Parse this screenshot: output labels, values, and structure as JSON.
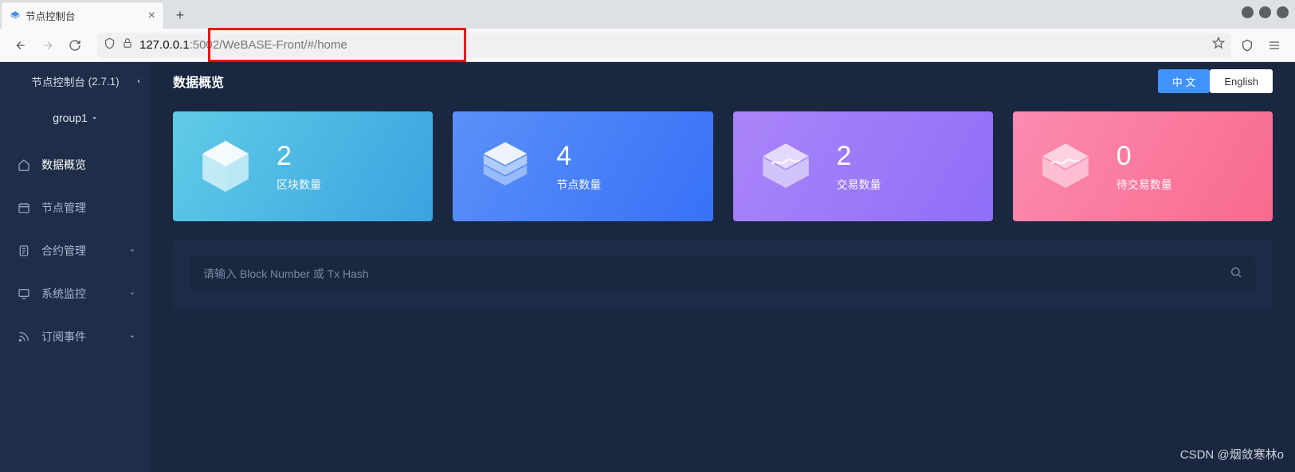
{
  "browser": {
    "tab_title": "节点控制台",
    "url_host": "127.0.0.1",
    "url_rest": ":5002/WeBASE-Front/#/home"
  },
  "sidebar": {
    "app_name": "节点控制台",
    "version": "(2.7.1)",
    "group_label": "group1",
    "items": [
      {
        "label": "数据概览",
        "icon": "home-icon",
        "active": true
      },
      {
        "label": "节点管理",
        "icon": "calendar-icon"
      },
      {
        "label": "合约管理",
        "icon": "clipboard-icon",
        "expandable": true
      },
      {
        "label": "系统监控",
        "icon": "monitor-icon",
        "expandable": true
      },
      {
        "label": "订阅事件",
        "icon": "rss-icon",
        "expandable": true
      }
    ]
  },
  "header": {
    "page_title": "数据概览",
    "lang_cn": "中 文",
    "lang_en": "English"
  },
  "cards": [
    {
      "value": "2",
      "label": "区块数量",
      "class": "c1"
    },
    {
      "value": "4",
      "label": "节点数量",
      "class": "c2"
    },
    {
      "value": "2",
      "label": "交易数量",
      "class": "c3"
    },
    {
      "value": "0",
      "label": "待交易数量",
      "class": "c4"
    }
  ],
  "search": {
    "placeholder": "请输入 Block Number 或 Tx Hash"
  },
  "watermark": "CSDN @烟敛寒林o"
}
